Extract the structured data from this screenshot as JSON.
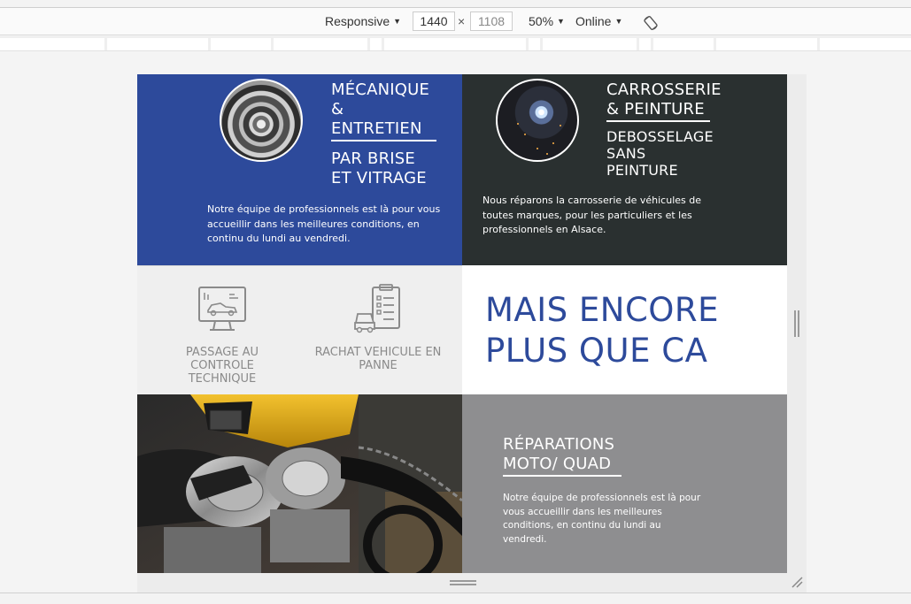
{
  "devtools": {
    "device": "Responsive",
    "width": "1440",
    "height": "1108",
    "times_sign": "×",
    "zoom": "50%",
    "throttling": "Online",
    "rotate_icon": "rotate-icon"
  },
  "site": {
    "mecanique": {
      "title_line1": "MÉCANIQUE",
      "title_line2": "&",
      "title_line3": "ENTRETIEN",
      "sub_line1": "PAR BRISE",
      "sub_line2": "ET VITRAGE",
      "text": "Notre équipe de professionnels est là pour vous accueillir dans les meilleures conditions, en continu du lundi au vendredi."
    },
    "carrosserie": {
      "title_line1": "CARROSSERIE",
      "title_line2": "& PEINTURE",
      "sub_line1": "DEBOSSELAGE",
      "sub_line2": "SANS",
      "sub_line3": "PEINTURE",
      "text": "Nous réparons la carrosserie de véhicules de toutes marques, pour les particuliers et les professionnels en Alsace."
    },
    "services": [
      {
        "line1": "PASSAGE AU CONTROLE",
        "line2": "TECHNIQUE",
        "icon": "computer-diagnostic-icon"
      },
      {
        "line1": "RACHAT VEHICULE EN",
        "line2": "PANNE",
        "icon": "car-checklist-icon"
      }
    ],
    "headline": {
      "line1": "MAIS ENCORE",
      "line2": "PLUS QUE CA"
    },
    "moto": {
      "title_line1": "RÉPARATIONS",
      "title_line2": "MOTO/ QUAD",
      "text": "Notre équipe de professionnels est là pour vous accueillir dans les meilleures conditions, en continu du lundi au vendredi."
    }
  },
  "colors": {
    "blue": "#2d4a9b",
    "dark": "#2a3030",
    "grey_panel": "#8e8e90",
    "light_panel": "#efefef"
  }
}
